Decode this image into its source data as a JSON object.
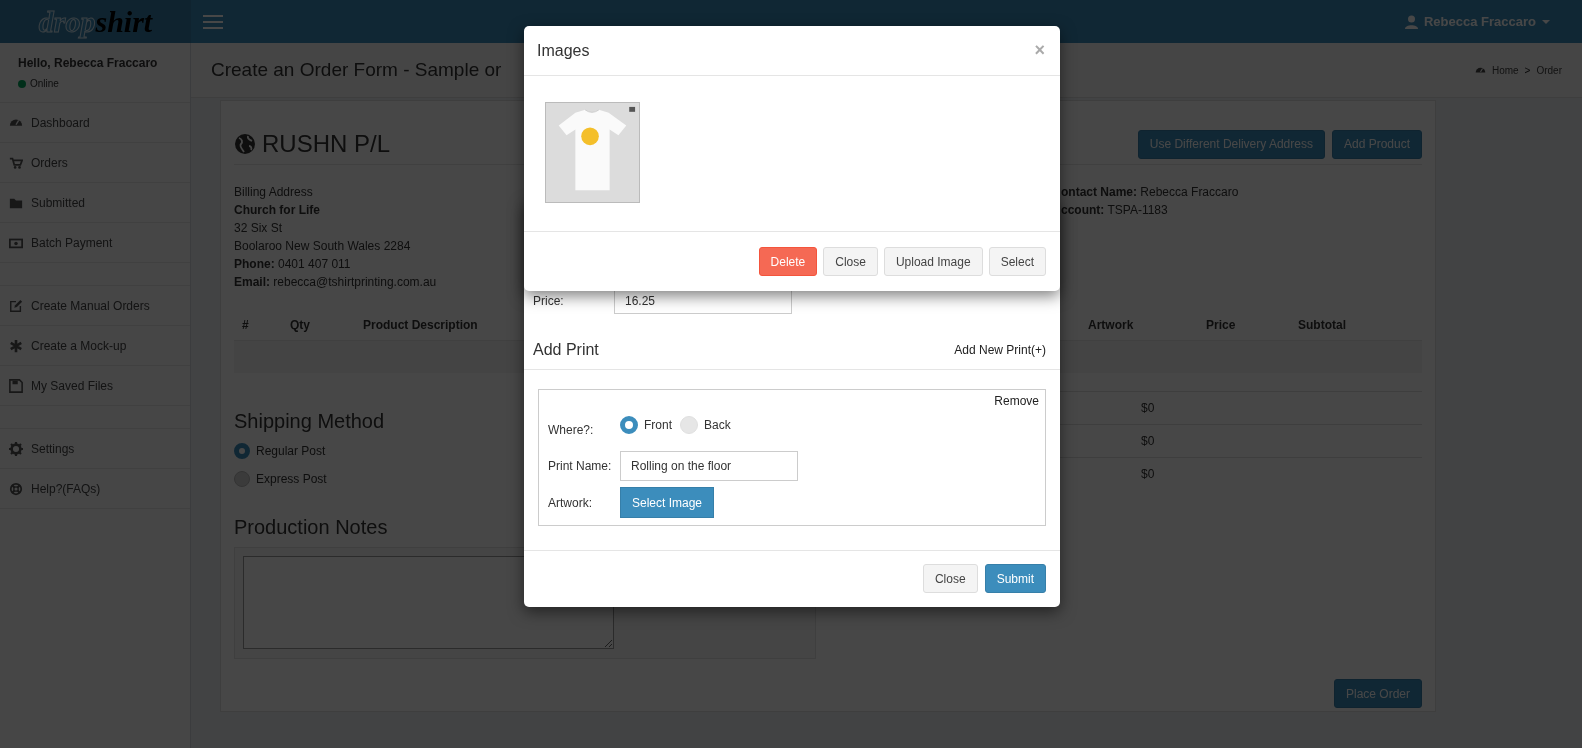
{
  "header": {
    "logo": [
      "drop",
      "shirt"
    ],
    "user": "Rebecca Fraccaro"
  },
  "sidebar": {
    "greeting": "Hello, Rebecca Fraccaro",
    "status": "Online",
    "sections": [
      {
        "items": [
          "Dashboard",
          "Orders",
          "Submitted",
          "Batch Payment"
        ]
      },
      {
        "items": [
          "Create Manual Orders",
          "Create a Mock-up",
          "My Saved Files"
        ]
      },
      {
        "items": [
          "Settings",
          "Help?(FAQs)"
        ]
      }
    ]
  },
  "page": {
    "title": "Create an Order Form - Sample or",
    "breadcrumb": {
      "items": [
        "Home",
        "Order"
      ],
      "separator": ">"
    }
  },
  "company": "RUSHN P/L",
  "actions": [
    "Use Different Delivery Address",
    "Add Product"
  ],
  "billing": {
    "heading": "Billing Address",
    "name": "Church for Life",
    "address": [
      "32 Six St",
      "Boolaroo New South Wales 2284"
    ],
    "details": [
      "**Phone:** 0401 407 011",
      "**Email:** rebecca@tshirtprinting.com.au"
    ]
  },
  "contact": [
    "**ontact Name:** Rebecca Fraccaro",
    "**ccount:** TSPA-1183"
  ],
  "table": {
    "columns": [
      "#",
      "Qty",
      "Product Description",
      "Artwork",
      "Price",
      "Subtotal"
    ],
    "rows": [
      {
        "value": "$0"
      },
      {
        "value": "$0"
      },
      {
        "value": "$0"
      }
    ]
  },
  "shipping": {
    "heading": "Shipping Method",
    "options": [
      {
        "label": "Regular Post",
        "selected": true
      },
      {
        "label": "Express Post",
        "selected": false
      }
    ]
  },
  "notes": {
    "heading": "Production Notes"
  },
  "place_order": "Place Order",
  "print_modal": {
    "price_label": "Price:",
    "price": "16.25",
    "heading": "Add Print",
    "add_new": "Add New Print(+)",
    "print": {
      "remove": "Remove",
      "where_label": "Where?:",
      "where": [
        {
          "label": "Front",
          "selected": true
        },
        {
          "label": "Back",
          "selected": false
        }
      ],
      "name_label": "Print Name:",
      "name": "Rolling on the floor",
      "artwork_label": "Artwork:",
      "artwork_button": "Select Image"
    },
    "buttons": [
      {
        "label": "Close",
        "kind": "default"
      },
      {
        "label": "Submit",
        "kind": "primary"
      }
    ]
  },
  "images_modal": {
    "title": "Images",
    "close": "×",
    "buttons": [
      {
        "label": "Delete",
        "kind": "danger"
      },
      {
        "label": "Close",
        "kind": "default"
      },
      {
        "label": "Upload Image",
        "kind": "default"
      },
      {
        "label": "Select",
        "kind": "default"
      }
    ]
  }
}
